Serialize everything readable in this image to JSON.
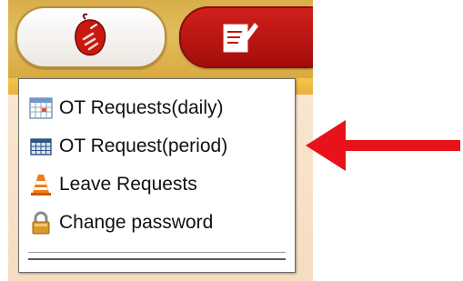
{
  "toolbar": {
    "left_button_icon": "mouse-click-icon",
    "right_button_icon": "edit-document-icon"
  },
  "menu": {
    "items": [
      {
        "label": "OT Requests(daily)",
        "icon": "calendar-icon"
      },
      {
        "label": "OT Request(period)",
        "icon": "grid-calendar-icon"
      },
      {
        "label": "Leave Requests",
        "icon": "traffic-cone-icon"
      },
      {
        "label": "Change password",
        "icon": "padlock-icon"
      }
    ]
  },
  "annotation": {
    "arrow_color": "#e8131a",
    "points_to": "OT Request(period)"
  },
  "colors": {
    "toolbar_gold": "#d8ae4a",
    "accent_red": "#c4160f",
    "menu_bg": "#ffffff"
  }
}
